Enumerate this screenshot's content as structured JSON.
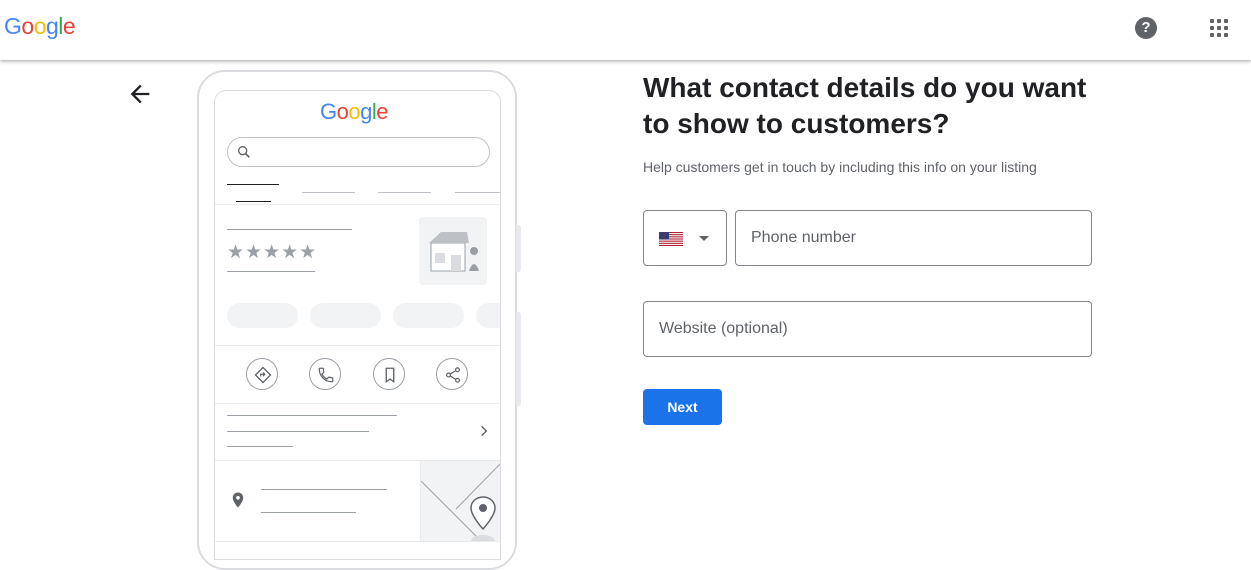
{
  "header": {
    "logo_letters": [
      {
        "char": "G",
        "color": "#4285F4"
      },
      {
        "char": "o",
        "color": "#EA4335"
      },
      {
        "char": "o",
        "color": "#FBBC05"
      },
      {
        "char": "g",
        "color": "#4285F4"
      },
      {
        "char": "l",
        "color": "#34A853"
      },
      {
        "char": "e",
        "color": "#EA4335"
      }
    ],
    "help_icon": "help-circle-icon",
    "help_symbol": "?",
    "apps_icon": "apps-grid-icon"
  },
  "illustration": {
    "stars": "★★★★★",
    "icons": [
      "directions-icon",
      "call-icon",
      "bookmark-icon",
      "share-icon",
      "chevron-right-icon",
      "location-pin-icon",
      "storefront-icon",
      "search-icon"
    ]
  },
  "form": {
    "title": "What contact details do you want to show to customers?",
    "subtitle": "Help customers get in touch by including this info on your listing",
    "country_icon": "us-flag-icon",
    "phone_placeholder": "Phone number",
    "phone_value": "",
    "website_placeholder": "Website (optional)",
    "website_value": "",
    "next_label": "Next"
  },
  "colors": {
    "primary": "#1a73e8",
    "text": "#202124",
    "secondary_text": "#5f6368",
    "border": "#80868b"
  }
}
